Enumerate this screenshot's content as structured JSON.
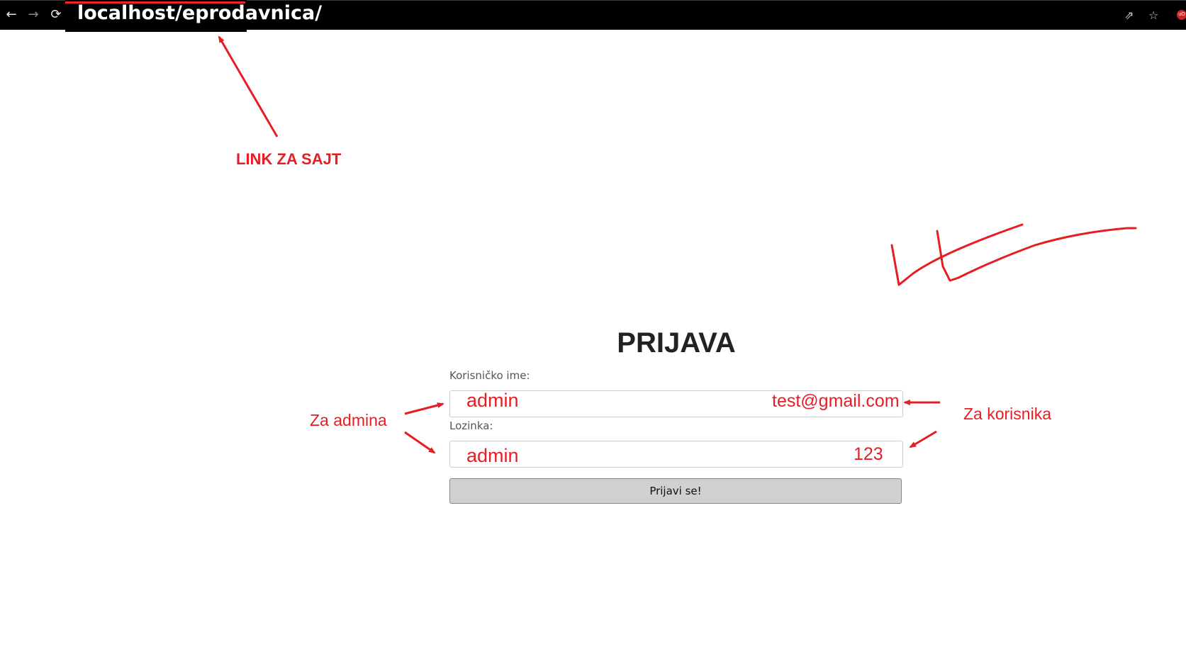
{
  "browser": {
    "url": "localhost/eprodavnica/",
    "back_icon": "←",
    "forward_icon": "→",
    "reload_icon": "⟳",
    "share_icon": "⇗",
    "star_icon": "☆",
    "extension_label": "uO"
  },
  "login": {
    "title": "PRIJAVA",
    "username_label": "Korisničko ime:",
    "password_label": "Lozinka:",
    "submit_label": "Prijavi se!"
  },
  "annotations": {
    "link_note": "LINK ZA SAJT",
    "admin_note": "Za admina",
    "user_note": "Za korisnika",
    "admin_username": "admin",
    "admin_password": "admin",
    "user_username": "test@gmail.com",
    "user_password": "123"
  },
  "colors": {
    "annotation": "#e61e24",
    "topbar": "#000000",
    "button_bg": "#d0d0d0"
  }
}
